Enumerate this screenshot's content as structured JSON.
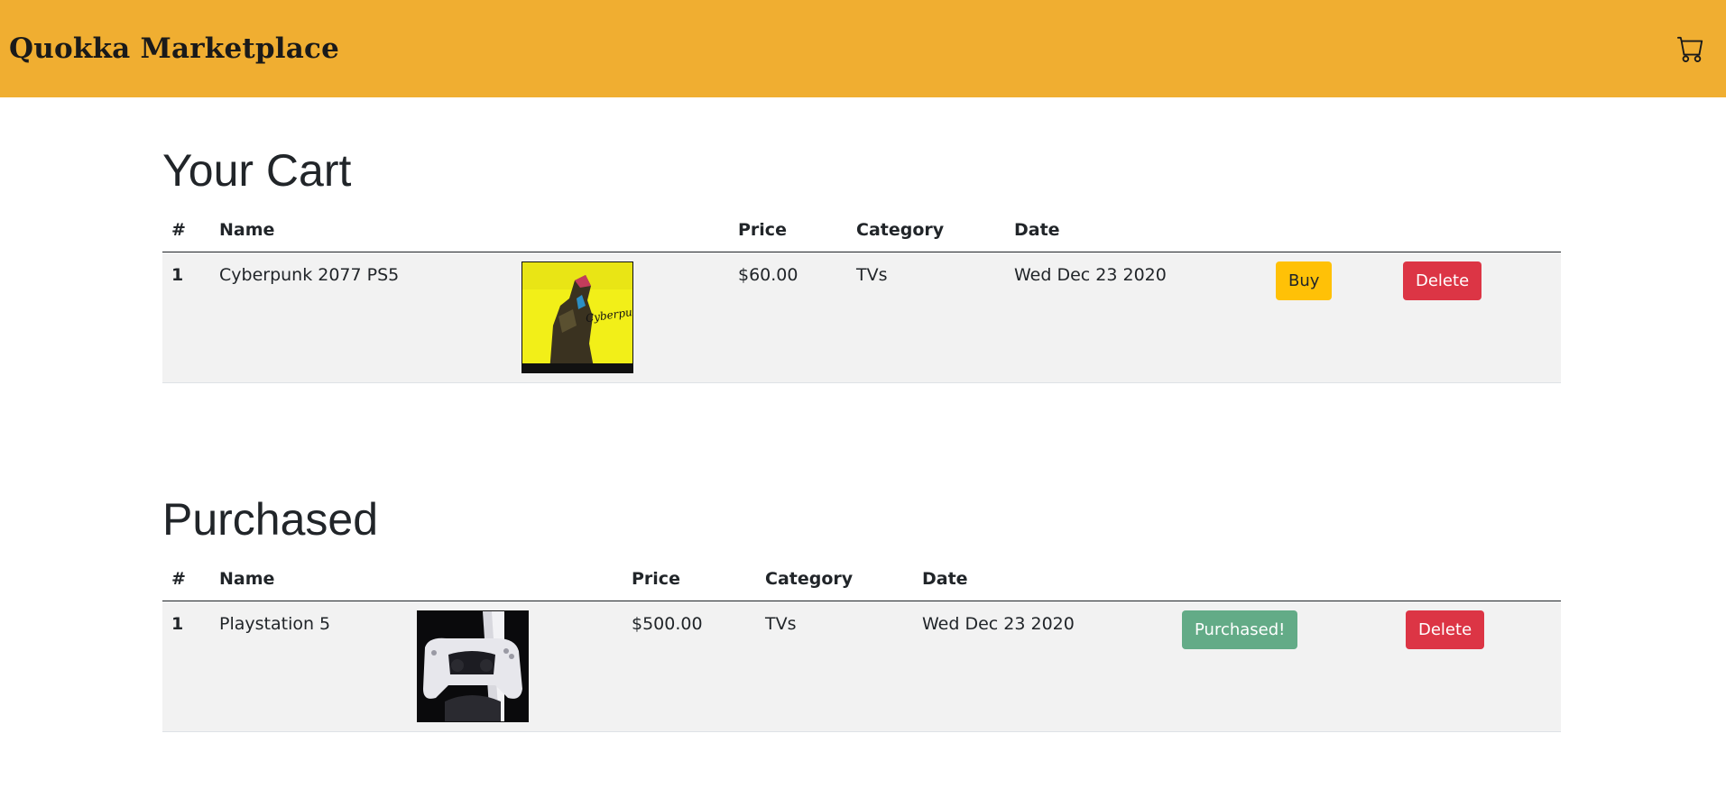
{
  "header": {
    "brand": "Quokka Marketplace",
    "cart_icon": "cart-icon"
  },
  "cart": {
    "title": "Your Cart",
    "columns": {
      "num": "#",
      "name": "Name",
      "price": "Price",
      "category": "Category",
      "date": "Date"
    },
    "rows": [
      {
        "num": "1",
        "name": "Cyberpunk 2077 PS5",
        "price": "$60.00",
        "category": "TVs",
        "date": "Wed Dec 23 2020",
        "buy_label": "Buy",
        "delete_label": "Delete"
      }
    ]
  },
  "purchased": {
    "title": "Purchased",
    "columns": {
      "num": "#",
      "name": "Name",
      "price": "Price",
      "category": "Category",
      "date": "Date"
    },
    "rows": [
      {
        "num": "1",
        "name": "Playstation 5",
        "price": "$500.00",
        "category": "TVs",
        "date": "Wed Dec 23 2020",
        "status_label": "Purchased!",
        "delete_label": "Delete"
      }
    ]
  },
  "colors": {
    "header_bg": "#f0ae31",
    "buy": "#ffc107",
    "delete": "#dc3545",
    "purchased": "#63ab87",
    "row_bg": "#f2f2f2"
  }
}
